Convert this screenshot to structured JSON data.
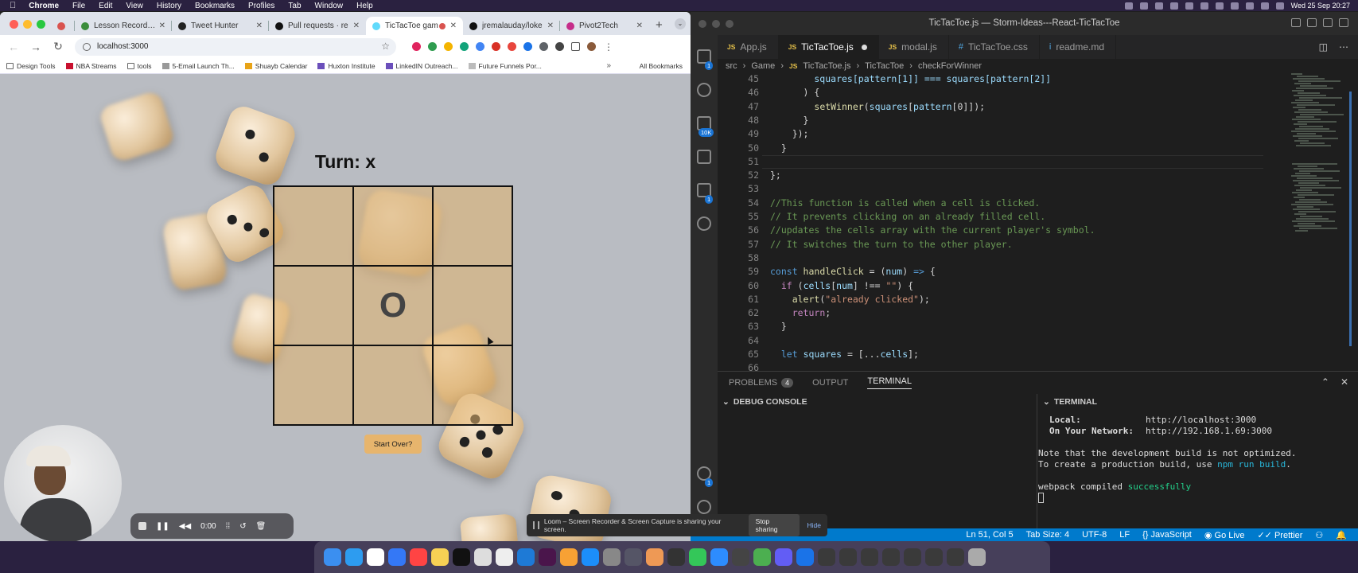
{
  "menubar": {
    "app": "Chrome",
    "items": [
      "File",
      "Edit",
      "View",
      "History",
      "Bookmarks",
      "Profiles",
      "Tab",
      "Window",
      "Help"
    ],
    "clock": "Wed 25 Sep 20:27"
  },
  "chrome": {
    "tabs": [
      {
        "label": "Lesson Recording",
        "color": "#3c8d3c"
      },
      {
        "label": "Tweet Hunter",
        "color": "#222"
      },
      {
        "label": "Pull requests · re",
        "color": "#111"
      },
      {
        "label": "TicTacToe gam",
        "color": "#61dafb",
        "active": true
      },
      {
        "label": "jremalauday/loke",
        "color": "#111"
      },
      {
        "label": "Pivot2Tech",
        "color": "#c62d8a"
      }
    ],
    "new_tab": "+",
    "url": "localhost:3000",
    "bookmarks": [
      {
        "label": "Design Tools",
        "type": "folder"
      },
      {
        "label": "NBA Streams",
        "type": "site",
        "color": "#c8102e"
      },
      {
        "label": "tools",
        "type": "folder"
      },
      {
        "label": "5-Email Launch Th...",
        "type": "site",
        "color": "#999"
      },
      {
        "label": "Shuayb Calendar",
        "type": "site",
        "color": "#e8a317"
      },
      {
        "label": "Huxton Institute",
        "type": "site",
        "color": "#6b4fbb"
      },
      {
        "label": "LinkedIN Outreach...",
        "type": "site",
        "color": "#6b4fbb"
      },
      {
        "label": "Future Funnels Por...",
        "type": "site",
        "color": "#bbb"
      }
    ],
    "all_bookmarks": "All Bookmarks"
  },
  "game": {
    "turn_label": "Turn: x",
    "cells": [
      "",
      "",
      "",
      "",
      "O",
      "",
      "",
      "",
      ""
    ],
    "start_over": "Start Over?"
  },
  "recorder": {
    "timer": "0:00"
  },
  "loom": {
    "message": "Loom – Screen Recorder & Screen Capture is sharing your screen.",
    "stop": "Stop sharing",
    "hide": "Hide"
  },
  "vscode": {
    "title": "TicTacToe.js — Storm-Ideas---React-TicTacToe",
    "tabs": [
      {
        "label": "App.js",
        "icon": "JS"
      },
      {
        "label": "TicTacToe.js",
        "icon": "JS",
        "active": true,
        "modified": true
      },
      {
        "label": "modal.js",
        "icon": "JS"
      },
      {
        "label": "TicTacToe.css",
        "icon": "#"
      },
      {
        "label": "readme.md",
        "icon": "i"
      }
    ],
    "breadcrumbs": [
      "src",
      "Game",
      "TicTacToe.js",
      "TicTacToe",
      "checkForWinner"
    ],
    "badges": {
      "explorer": "1",
      "scm": "10K",
      "ext": "1",
      "account": "1"
    },
    "panel": {
      "tabs": [
        "PROBLEMS",
        "OUTPUT",
        "TERMINAL"
      ],
      "problems_count": "4",
      "debug_header": "DEBUG CONSOLE",
      "terminal_header": "TERMINAL",
      "terminal": {
        "local_label": "Local:",
        "local_url": "http://localhost:3000",
        "network_label": "On Your Network:",
        "network_url": "http://192.168.1.69:3000",
        "note1": "Note that the development build is not optimized.",
        "note2_prefix": "To create a production build, use ",
        "note2_cmd": "npm run build",
        "note2_suffix": ".",
        "compiled_prefix": "webpack compiled ",
        "compiled_status": "successfully"
      }
    },
    "status": {
      "position": "Ln 51, Col 5",
      "tab_size": "Tab Size: 4",
      "encoding": "UTF-8",
      "eol": "LF",
      "language": "{} JavaScript",
      "golive": "Go Live",
      "prettier": "Prettier"
    }
  }
}
